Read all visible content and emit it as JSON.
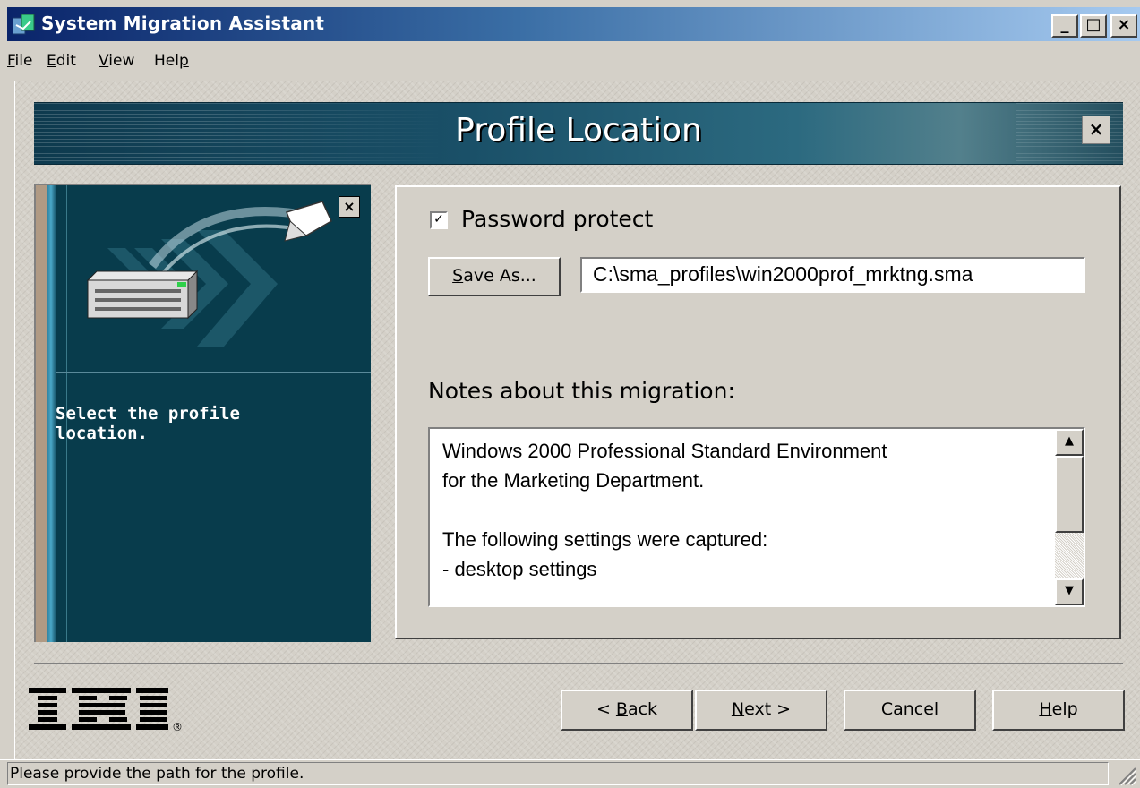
{
  "window": {
    "title": "System Migration Assistant",
    "min_glyph": "_",
    "max_glyph": "□",
    "close_glyph": "×"
  },
  "menu": {
    "file": {
      "u": "F",
      "rest": "ile"
    },
    "edit": {
      "u": "E",
      "rest": "dit"
    },
    "view": {
      "u": "V",
      "rest": "iew"
    },
    "help": {
      "pre": "Hel",
      "u": "p"
    }
  },
  "banner": {
    "title": "Profile Location",
    "close_glyph": "×"
  },
  "left_panel": {
    "instruction": "Select the profile location.",
    "close_glyph": "×"
  },
  "form": {
    "password_protect_label": "Password protect",
    "password_protect_checked": true,
    "check_glyph": "✓",
    "save_as": {
      "u": "S",
      "rest": "ave As..."
    },
    "profile_path": "C:\\sma_profiles\\win2000prof_mrktng.sma",
    "notes_label": "Notes about this migration:",
    "notes_text": "Windows 2000 Professional Standard Environment\nfor the Marketing Department.\n\nThe following settings were captured:\n- desktop settings",
    "scroll_up_glyph": "▲",
    "scroll_down_glyph": "▼"
  },
  "buttons": {
    "back": {
      "pre": "< ",
      "u": "B",
      "rest": "ack"
    },
    "next": {
      "u": "N",
      "rest": "ext >"
    },
    "cancel": "Cancel",
    "help": {
      "u": "H",
      "rest": "elp"
    }
  },
  "logo": {
    "text": "IBM",
    "registered": "®"
  },
  "status": {
    "text": "Please provide the path for the profile."
  },
  "icons": [
    "app-icon",
    "minimize-icon",
    "maximize-icon",
    "close-icon",
    "server-icon",
    "document-icon",
    "checkbox-icon",
    "scroll-up-icon",
    "scroll-down-icon",
    "size-grip-icon"
  ]
}
